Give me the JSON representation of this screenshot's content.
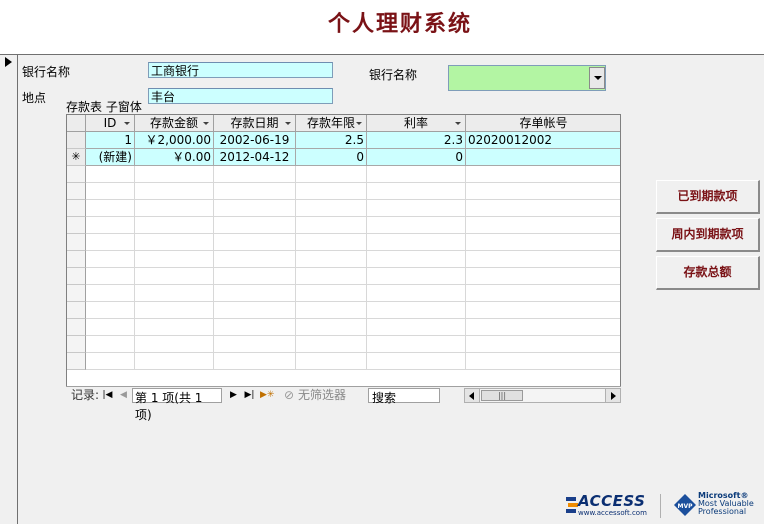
{
  "header": {
    "title": "个人理财系统"
  },
  "form": {
    "bank_name_label": "银行名称",
    "bank_name_value": "工商银行",
    "location_label": "地点",
    "location_value": "丰台",
    "combo_label": "银行名称",
    "combo_value": "",
    "subform_label": "存款表 子窗体"
  },
  "grid": {
    "columns": [
      "ID",
      "存款金额",
      "存款日期",
      "存款年限",
      "利率",
      "存单帐号"
    ],
    "rows": [
      {
        "selector": "",
        "id": "1",
        "amount": "￥2,000.00",
        "date": "2002-06-19",
        "years": "2.5",
        "rate": "2.3",
        "account": "02020012002"
      },
      {
        "selector": "✳",
        "id": "(新建)",
        "amount": "￥0.00",
        "date": "2012-04-12",
        "years": "0",
        "rate": "0",
        "account": ""
      }
    ]
  },
  "nav": {
    "record_label": "记录:",
    "current": "第 1 项(共 1 项)",
    "filter": "无筛选器",
    "search": "搜索"
  },
  "buttons": {
    "due": "已到期款项",
    "due_week": "周内到期款项",
    "total": "存款总额"
  },
  "logos": {
    "access": "ACCESS",
    "access_url": "www.accessoft.com",
    "mvp_line1": "Microsoft®",
    "mvp_line2": "Most Valuable",
    "mvp_line3": "Professional",
    "mvp_badge": "MVP"
  }
}
